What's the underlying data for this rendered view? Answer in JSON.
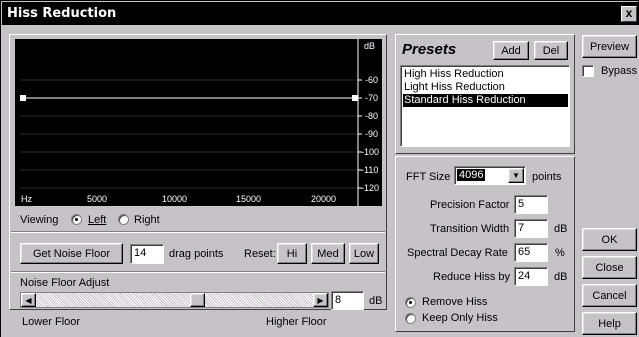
{
  "window": {
    "title": "Hiss Reduction",
    "close": "x"
  },
  "graph": {
    "unit": "dB",
    "y_ticks": [
      "-60",
      "-70",
      "-80",
      "-90",
      "-100",
      "-110",
      "-120"
    ],
    "x_unit": "Hz",
    "x_ticks": [
      "5000",
      "10000",
      "15000",
      "20000"
    ]
  },
  "viewing": {
    "label": "Viewing",
    "left": "Left",
    "right": "Right",
    "selected": "Left"
  },
  "noise_floor": {
    "get_button": "Get Noise Floor",
    "drag_points": "14",
    "drag_points_label": "drag points",
    "reset_label": "Reset:",
    "reset_hi": "Hi",
    "reset_med": "Med",
    "reset_low": "Low",
    "adjust_label": "Noise Floor Adjust",
    "adjust_value": "8",
    "adjust_unit": "dB",
    "slider_fraction": 0.47,
    "lower": "Lower Floor",
    "higher": "Higher Floor"
  },
  "presets": {
    "title": "Presets",
    "add": "Add",
    "del": "Del",
    "items": [
      "High Hiss Reduction",
      "Light Hiss Reduction",
      "Standard Hiss Reduction"
    ],
    "selected_index": 2
  },
  "settings": {
    "fft_label": "FFT Size",
    "fft_value": "4096",
    "fft_unit": "points",
    "precision_label": "Precision Factor",
    "precision_value": "5",
    "transition_label": "Transition Width",
    "transition_value": "7",
    "transition_unit": "dB",
    "decay_label": "Spectral Decay Rate",
    "decay_value": "65",
    "decay_unit": "%",
    "reduce_label": "Reduce Hiss by",
    "reduce_value": "24",
    "reduce_unit": "dB",
    "remove_hiss": "Remove Hiss",
    "keep_hiss": "Keep Only Hiss",
    "mode_selected": "Remove Hiss"
  },
  "side": {
    "preview": "Preview",
    "bypass": "Bypass",
    "ok": "OK",
    "close": "Close",
    "cancel": "Cancel",
    "help": "Help"
  }
}
